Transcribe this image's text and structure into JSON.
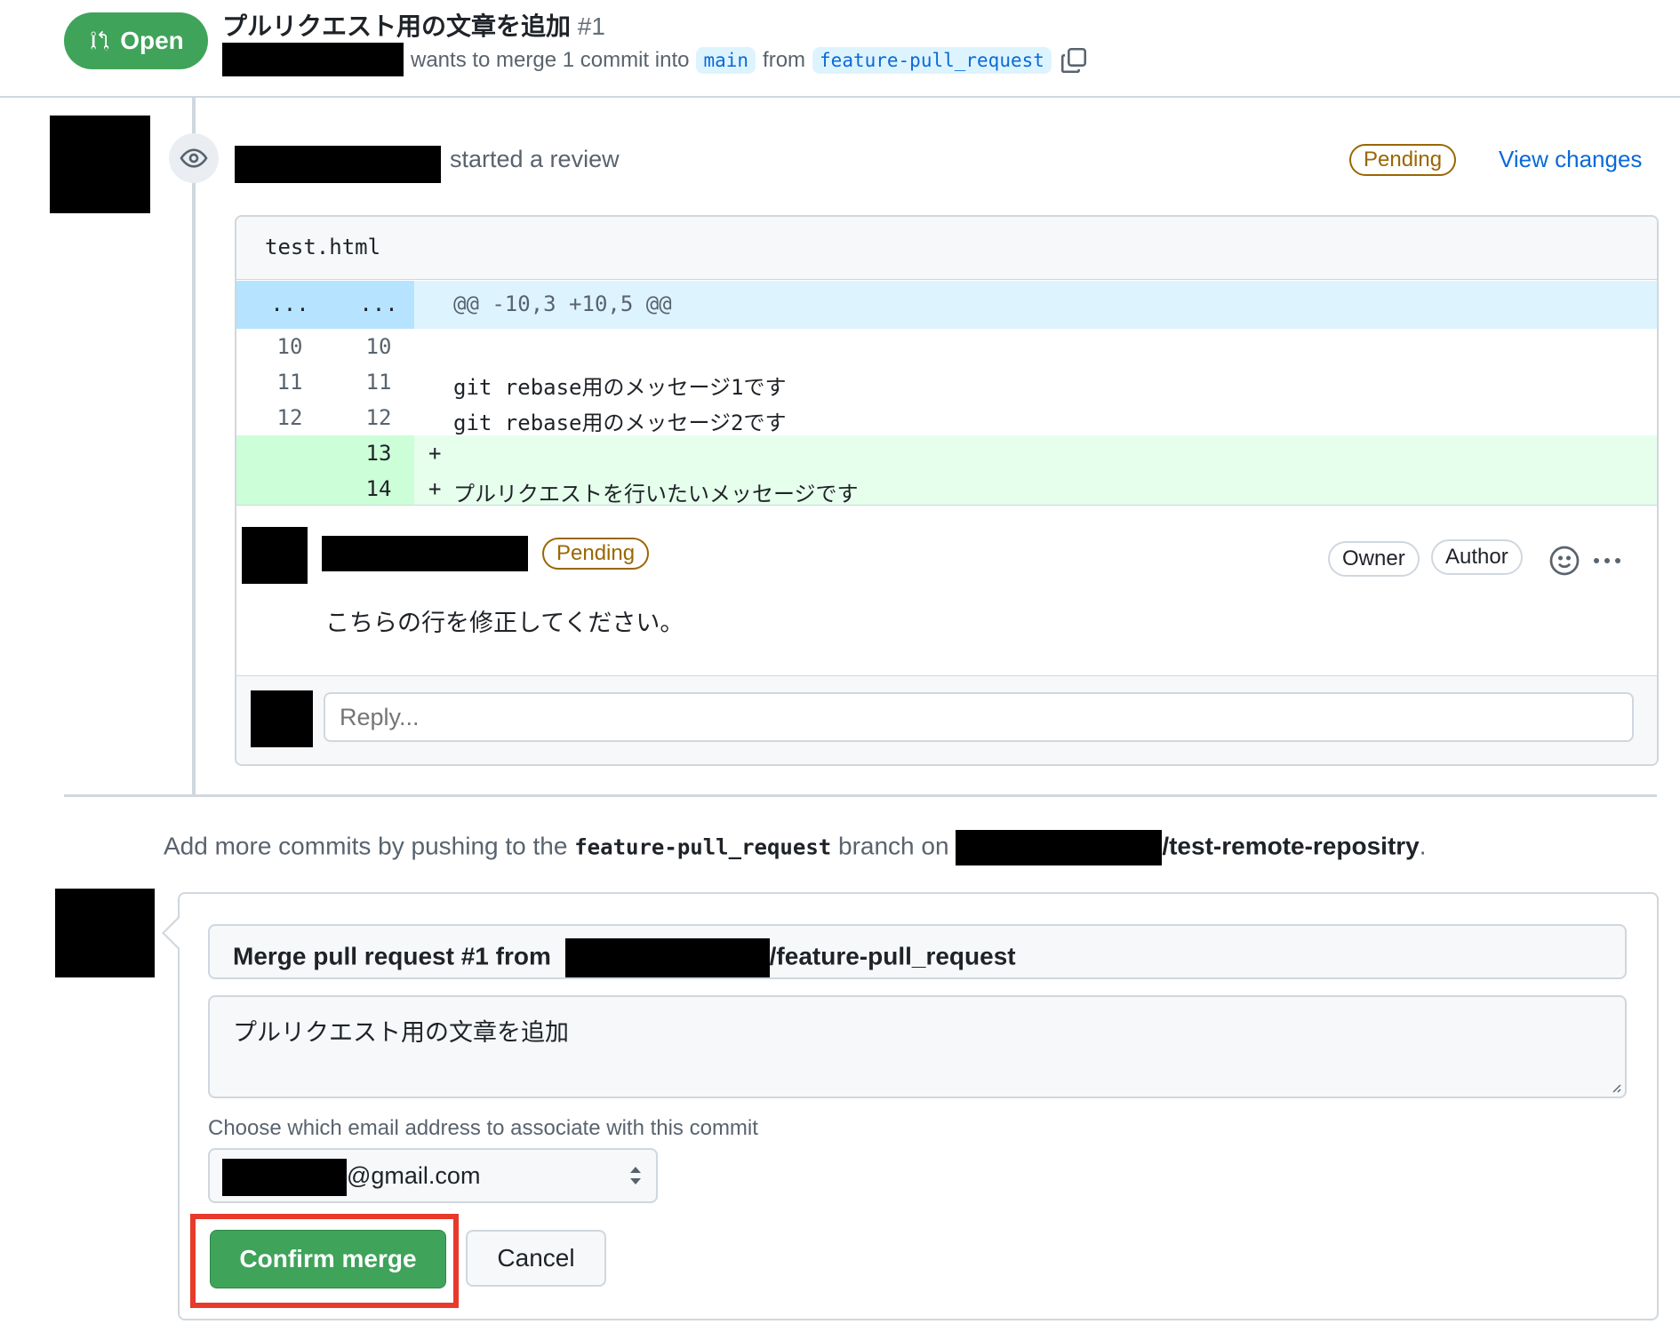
{
  "header": {
    "status": "Open",
    "title": "プルリクエスト用の文章を追加",
    "number": "#1",
    "merge_text": "wants to merge 1 commit into",
    "base_branch": "main",
    "from_text": "from",
    "head_branch": "feature-pull_request"
  },
  "review": {
    "action": "started a review",
    "state": "Pending",
    "view_changes": "View changes",
    "file_name": "test.html",
    "hunk": {
      "left": "...",
      "right": "...",
      "header": "@@ -10,3 +10,5 @@"
    },
    "lines": [
      {
        "old": "10",
        "new": "10",
        "sign": "",
        "code": ""
      },
      {
        "old": "11",
        "new": "11",
        "sign": "",
        "code": "git rebase用のメッセージ1です"
      },
      {
        "old": "12",
        "new": "12",
        "sign": "",
        "code": "git rebase用のメッセージ2です"
      },
      {
        "old": "",
        "new": "13",
        "sign": "+",
        "code": ""
      },
      {
        "old": "",
        "new": "14",
        "sign": "+",
        "code": "プルリクエストを行いたいメッセージです"
      }
    ],
    "comment": {
      "state": "Pending",
      "chip_owner": "Owner",
      "chip_author": "Author",
      "body": "こちらの行を修正してください。"
    },
    "reply_placeholder": "Reply..."
  },
  "push_hint": {
    "prefix": "Add more commits by pushing to the",
    "branch": "feature-pull_request",
    "middle": "branch on",
    "repo_suffix": "/test-remote-repositry",
    "period": "."
  },
  "merge": {
    "title_prefix": "Merge pull request #1 from",
    "title_suffix": "/feature-pull_request",
    "body": "プルリクエスト用の文章を追加",
    "email_label": "Choose which email address to associate with this commit",
    "email_suffix": "@gmail.com",
    "confirm_label": "Confirm merge",
    "cancel_label": "Cancel"
  },
  "colors": {
    "open_green": "#3fa35a",
    "link_blue": "#0969da",
    "pending_brown": "#9a6700",
    "highlight_red": "#e8392b"
  }
}
